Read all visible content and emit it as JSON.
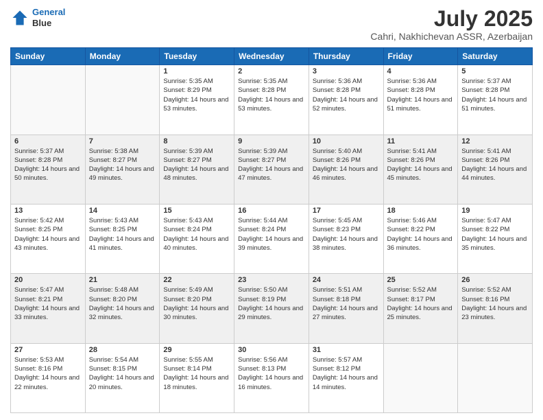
{
  "header": {
    "logo": {
      "line1": "General",
      "line2": "Blue"
    },
    "title": "July 2025",
    "location": "Cahri, Nakhichevan ASSR, Azerbaijan"
  },
  "days_of_week": [
    "Sunday",
    "Monday",
    "Tuesday",
    "Wednesday",
    "Thursday",
    "Friday",
    "Saturday"
  ],
  "weeks": [
    {
      "days": [
        {
          "num": "",
          "info": ""
        },
        {
          "num": "",
          "info": ""
        },
        {
          "num": "1",
          "info": "Sunrise: 5:35 AM\nSunset: 8:29 PM\nDaylight: 14 hours and 53 minutes."
        },
        {
          "num": "2",
          "info": "Sunrise: 5:35 AM\nSunset: 8:28 PM\nDaylight: 14 hours and 53 minutes."
        },
        {
          "num": "3",
          "info": "Sunrise: 5:36 AM\nSunset: 8:28 PM\nDaylight: 14 hours and 52 minutes."
        },
        {
          "num": "4",
          "info": "Sunrise: 5:36 AM\nSunset: 8:28 PM\nDaylight: 14 hours and 51 minutes."
        },
        {
          "num": "5",
          "info": "Sunrise: 5:37 AM\nSunset: 8:28 PM\nDaylight: 14 hours and 51 minutes."
        }
      ]
    },
    {
      "days": [
        {
          "num": "6",
          "info": "Sunrise: 5:37 AM\nSunset: 8:28 PM\nDaylight: 14 hours and 50 minutes."
        },
        {
          "num": "7",
          "info": "Sunrise: 5:38 AM\nSunset: 8:27 PM\nDaylight: 14 hours and 49 minutes."
        },
        {
          "num": "8",
          "info": "Sunrise: 5:39 AM\nSunset: 8:27 PM\nDaylight: 14 hours and 48 minutes."
        },
        {
          "num": "9",
          "info": "Sunrise: 5:39 AM\nSunset: 8:27 PM\nDaylight: 14 hours and 47 minutes."
        },
        {
          "num": "10",
          "info": "Sunrise: 5:40 AM\nSunset: 8:26 PM\nDaylight: 14 hours and 46 minutes."
        },
        {
          "num": "11",
          "info": "Sunrise: 5:41 AM\nSunset: 8:26 PM\nDaylight: 14 hours and 45 minutes."
        },
        {
          "num": "12",
          "info": "Sunrise: 5:41 AM\nSunset: 8:26 PM\nDaylight: 14 hours and 44 minutes."
        }
      ]
    },
    {
      "days": [
        {
          "num": "13",
          "info": "Sunrise: 5:42 AM\nSunset: 8:25 PM\nDaylight: 14 hours and 43 minutes."
        },
        {
          "num": "14",
          "info": "Sunrise: 5:43 AM\nSunset: 8:25 PM\nDaylight: 14 hours and 41 minutes."
        },
        {
          "num": "15",
          "info": "Sunrise: 5:43 AM\nSunset: 8:24 PM\nDaylight: 14 hours and 40 minutes."
        },
        {
          "num": "16",
          "info": "Sunrise: 5:44 AM\nSunset: 8:24 PM\nDaylight: 14 hours and 39 minutes."
        },
        {
          "num": "17",
          "info": "Sunrise: 5:45 AM\nSunset: 8:23 PM\nDaylight: 14 hours and 38 minutes."
        },
        {
          "num": "18",
          "info": "Sunrise: 5:46 AM\nSunset: 8:22 PM\nDaylight: 14 hours and 36 minutes."
        },
        {
          "num": "19",
          "info": "Sunrise: 5:47 AM\nSunset: 8:22 PM\nDaylight: 14 hours and 35 minutes."
        }
      ]
    },
    {
      "days": [
        {
          "num": "20",
          "info": "Sunrise: 5:47 AM\nSunset: 8:21 PM\nDaylight: 14 hours and 33 minutes."
        },
        {
          "num": "21",
          "info": "Sunrise: 5:48 AM\nSunset: 8:20 PM\nDaylight: 14 hours and 32 minutes."
        },
        {
          "num": "22",
          "info": "Sunrise: 5:49 AM\nSunset: 8:20 PM\nDaylight: 14 hours and 30 minutes."
        },
        {
          "num": "23",
          "info": "Sunrise: 5:50 AM\nSunset: 8:19 PM\nDaylight: 14 hours and 29 minutes."
        },
        {
          "num": "24",
          "info": "Sunrise: 5:51 AM\nSunset: 8:18 PM\nDaylight: 14 hours and 27 minutes."
        },
        {
          "num": "25",
          "info": "Sunrise: 5:52 AM\nSunset: 8:17 PM\nDaylight: 14 hours and 25 minutes."
        },
        {
          "num": "26",
          "info": "Sunrise: 5:52 AM\nSunset: 8:16 PM\nDaylight: 14 hours and 23 minutes."
        }
      ]
    },
    {
      "days": [
        {
          "num": "27",
          "info": "Sunrise: 5:53 AM\nSunset: 8:16 PM\nDaylight: 14 hours and 22 minutes."
        },
        {
          "num": "28",
          "info": "Sunrise: 5:54 AM\nSunset: 8:15 PM\nDaylight: 14 hours and 20 minutes."
        },
        {
          "num": "29",
          "info": "Sunrise: 5:55 AM\nSunset: 8:14 PM\nDaylight: 14 hours and 18 minutes."
        },
        {
          "num": "30",
          "info": "Sunrise: 5:56 AM\nSunset: 8:13 PM\nDaylight: 14 hours and 16 minutes."
        },
        {
          "num": "31",
          "info": "Sunrise: 5:57 AM\nSunset: 8:12 PM\nDaylight: 14 hours and 14 minutes."
        },
        {
          "num": "",
          "info": ""
        },
        {
          "num": "",
          "info": ""
        }
      ]
    }
  ]
}
